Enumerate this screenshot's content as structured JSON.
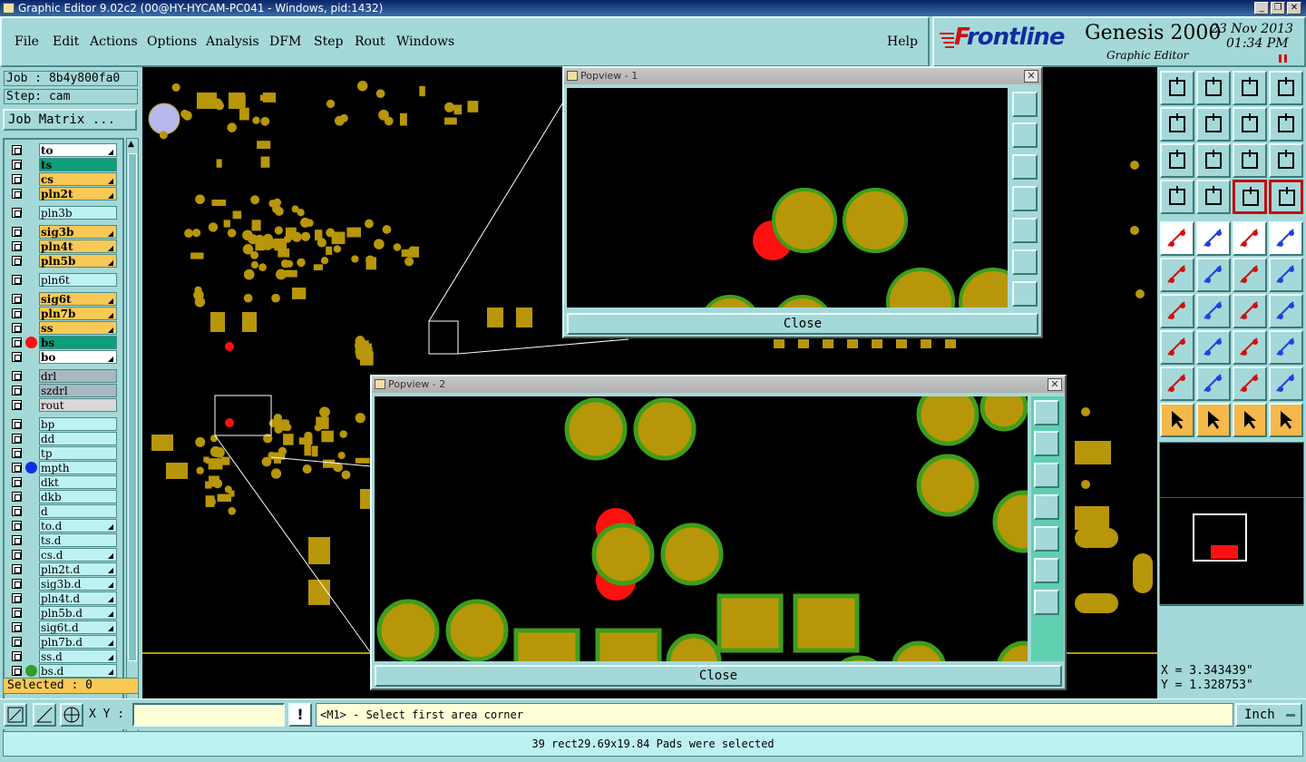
{
  "window": {
    "title": "Graphic Editor 9.02c2 (00@HY-HYCAM-PC041 - Windows, pid:1432)"
  },
  "menu": [
    "File",
    "Edit",
    "Actions",
    "Options",
    "Analysis",
    "DFM",
    "Step",
    "Rout",
    "Windows"
  ],
  "help_label": "Help",
  "brand": {
    "logo_prefix": "F",
    "logo_rest": "rontline",
    "product": "Genesis 2000",
    "subtitle": "Graphic Editor",
    "date": "23 Nov 2013",
    "time": "01:34 PM"
  },
  "job": {
    "job_label": "Job : 8b4y800fa0",
    "step_label": "Step: cam",
    "matrix_button": "Job Matrix ..."
  },
  "layers": [
    {
      "name": "to",
      "bg": "#ffffff",
      "tick": true,
      "bold": true,
      "gap": 0
    },
    {
      "name": "ts",
      "bg": "#0e9e7a",
      "tick": false,
      "bold": true,
      "gap": 0
    },
    {
      "name": "cs",
      "bg": "#f9c955",
      "tick": true,
      "bold": true,
      "gap": 0
    },
    {
      "name": "pln2t",
      "bg": "#f9c955",
      "tick": true,
      "bold": true,
      "gap": 0
    },
    {
      "name": "pln3b",
      "bg": "#bef2f2",
      "tick": false,
      "bold": false,
      "gap": 5
    },
    {
      "name": "sig3b",
      "bg": "#f9c955",
      "tick": true,
      "bold": true,
      "gap": 5
    },
    {
      "name": "pln4t",
      "bg": "#f9c955",
      "tick": true,
      "bold": true,
      "gap": 0
    },
    {
      "name": "pln5b",
      "bg": "#f9c955",
      "tick": true,
      "bold": true,
      "gap": 0
    },
    {
      "name": "pln6t",
      "bg": "#bef2f2",
      "tick": false,
      "bold": false,
      "gap": 5
    },
    {
      "name": "sig6t",
      "bg": "#f9c955",
      "tick": true,
      "bold": true,
      "gap": 5
    },
    {
      "name": "pln7b",
      "bg": "#f9c955",
      "tick": true,
      "bold": true,
      "gap": 0
    },
    {
      "name": "ss",
      "bg": "#f9c955",
      "tick": true,
      "bold": true,
      "gap": 0
    },
    {
      "name": "bs",
      "bg": "#0e9e7a",
      "tick": false,
      "bold": true,
      "gap": 0,
      "dot": "#ff1010"
    },
    {
      "name": "bo",
      "bg": "#ffffff",
      "tick": true,
      "bold": true,
      "gap": 0
    },
    {
      "name": "drl",
      "bg": "#a8b8c0",
      "tick": false,
      "bold": false,
      "gap": 5
    },
    {
      "name": "szdrl",
      "bg": "#a8b8c0",
      "tick": false,
      "bold": false,
      "gap": 0
    },
    {
      "name": "rout",
      "bg": "#d8d8d8",
      "tick": false,
      "bold": false,
      "gap": 0
    },
    {
      "name": "bp",
      "bg": "#bef2f2",
      "tick": false,
      "bold": false,
      "gap": 5
    },
    {
      "name": "dd",
      "bg": "#bef2f2",
      "tick": false,
      "bold": false,
      "gap": 0
    },
    {
      "name": "tp",
      "bg": "#bef2f2",
      "tick": false,
      "bold": false,
      "gap": 0
    },
    {
      "name": "mpth",
      "bg": "#bef2f2",
      "tick": false,
      "bold": false,
      "gap": 0,
      "dot": "#1030e0"
    },
    {
      "name": "dkt",
      "bg": "#bef2f2",
      "tick": false,
      "bold": false,
      "gap": 0
    },
    {
      "name": "dkb",
      "bg": "#bef2f2",
      "tick": false,
      "bold": false,
      "gap": 0
    },
    {
      "name": "d",
      "bg": "#bef2f2",
      "tick": false,
      "bold": false,
      "gap": 0
    },
    {
      "name": "to.d",
      "bg": "#bef2f2",
      "tick": true,
      "bold": false,
      "gap": 0
    },
    {
      "name": "ts.d",
      "bg": "#bef2f2",
      "tick": false,
      "bold": false,
      "gap": 0
    },
    {
      "name": "cs.d",
      "bg": "#bef2f2",
      "tick": true,
      "bold": false,
      "gap": 0
    },
    {
      "name": "pln2t.d",
      "bg": "#bef2f2",
      "tick": true,
      "bold": false,
      "gap": 0
    },
    {
      "name": "sig3b.d",
      "bg": "#bef2f2",
      "tick": true,
      "bold": false,
      "gap": 0
    },
    {
      "name": "pln4t.d",
      "bg": "#bef2f2",
      "tick": true,
      "bold": false,
      "gap": 0
    },
    {
      "name": "pln5b.d",
      "bg": "#bef2f2",
      "tick": true,
      "bold": false,
      "gap": 0
    },
    {
      "name": "sig6t.d",
      "bg": "#bef2f2",
      "tick": true,
      "bold": false,
      "gap": 0
    },
    {
      "name": "pln7b.d",
      "bg": "#bef2f2",
      "tick": true,
      "bold": false,
      "gap": 0
    },
    {
      "name": "ss.d",
      "bg": "#bef2f2",
      "tick": true,
      "bold": false,
      "gap": 0
    },
    {
      "name": "bs.d",
      "bg": "#bef2f2",
      "tick": true,
      "bold": false,
      "gap": 0,
      "dot": "#2e9e2e"
    }
  ],
  "selected_label": "Selected : 0",
  "popview1": {
    "title": "Popview - 1",
    "close_label": "Close"
  },
  "popview2": {
    "title": "Popview - 2",
    "close_label": "Close"
  },
  "coords": {
    "x": "X = 3.343439\"",
    "y": "Y = 1.328753\""
  },
  "xy_label": "X Y :",
  "xy_value": "",
  "prompt": "<M1> - Select first area corner",
  "units": "Inch",
  "status": "39 rect29.69x19.84 Pads were selected",
  "colors": {
    "pad": "#b8960a",
    "pad_rim": "#3f9e1a",
    "highlight": "#ff1010",
    "panel": "#a5d8d8"
  }
}
